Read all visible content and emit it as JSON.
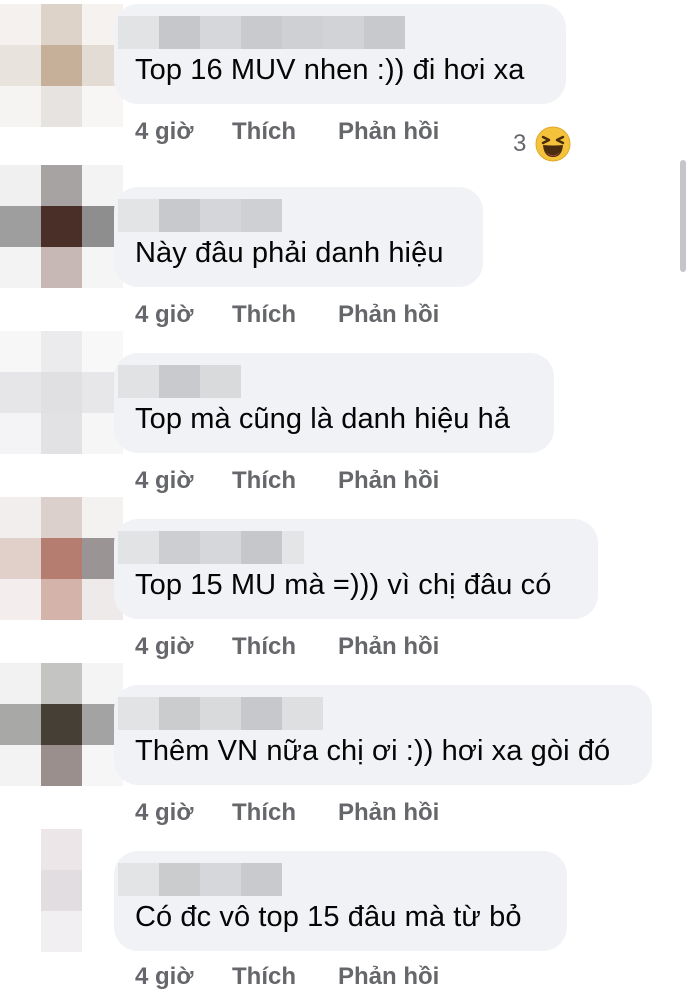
{
  "comments": [
    {
      "text": "Top 16 MUV nhen :)) đi hơi xa",
      "time": "4 giờ",
      "like": "Thích",
      "reply": "Phản hồi",
      "reaction_count": "3",
      "reaction_icon": "haha-emoji"
    },
    {
      "text": "Này đâu phải danh hiệu",
      "time": "4 giờ",
      "like": "Thích",
      "reply": "Phản hồi"
    },
    {
      "text": "Top mà cũng là danh hiệu hả",
      "time": "4 giờ",
      "like": "Thích",
      "reply": "Phản hồi"
    },
    {
      "text": "Top 15 MU mà =))) vì chị đâu có",
      "time": "4 giờ",
      "like": "Thích",
      "reply": "Phản hồi"
    },
    {
      "text": "Thêm VN nữa chị ơi :)) hơi xa gòi đó",
      "time": "4 giờ",
      "like": "Thích",
      "reply": "Phản hồi"
    },
    {
      "text": "Có đc vô top 15 đâu mà từ bỏ",
      "time": "4 giờ",
      "like": "Thích",
      "reply": "Phản hồi"
    }
  ],
  "colors": {
    "bubble": "#f0f2f5",
    "meta_text": "#65676b",
    "comment_text": "#050505",
    "scrollbar": "#c4c6c9"
  }
}
